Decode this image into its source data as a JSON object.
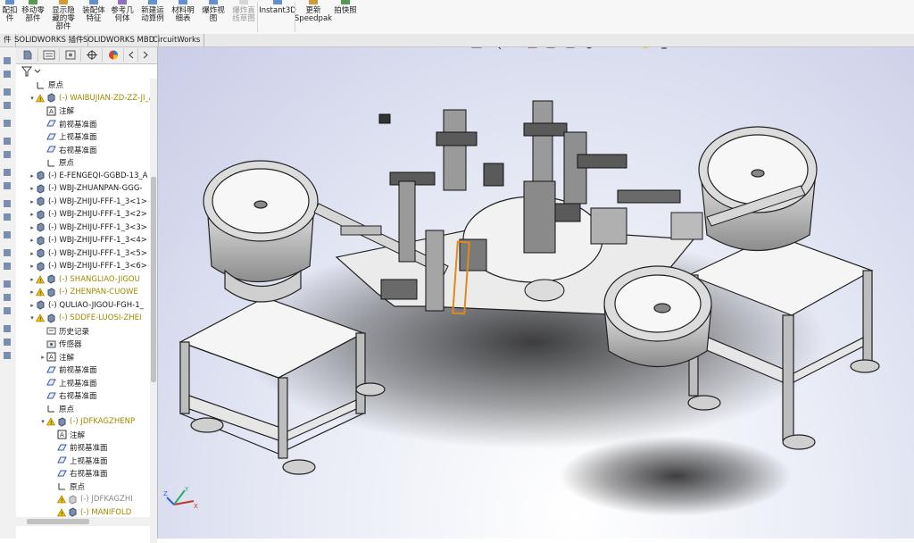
{
  "ribbon": {
    "items": [
      {
        "label": "配扣\n件",
        "icon": "mate-icon",
        "dim": false
      },
      {
        "label": "移动零\n部件",
        "icon": "move-component-icon",
        "dim": false
      },
      {
        "label": "显示隐\n藏的零\n部件",
        "icon": "show-hidden-icon",
        "dim": false
      },
      {
        "label": "装配体\n特征",
        "icon": "assembly-feature-icon",
        "dim": false
      },
      {
        "label": "参考几\n何体",
        "icon": "reference-geometry-icon",
        "dim": false
      },
      {
        "label": "新建运\n动算例",
        "icon": "motion-study-icon",
        "dim": false
      },
      {
        "label": "材料明\n细表",
        "icon": "bom-icon",
        "dim": false
      },
      {
        "label": "爆炸视\n图",
        "icon": "exploded-view-icon",
        "dim": false
      },
      {
        "label": "爆炸直\n线草图",
        "icon": "explode-line-sketch-icon",
        "dim": true
      },
      {
        "label": "Instant3D",
        "icon": "instant3d-icon",
        "dim": false
      },
      {
        "label": "更新\nSpeedpak",
        "icon": "speedpak-icon",
        "dim": false
      },
      {
        "label": "拍快照",
        "icon": "snapshot-icon",
        "dim": false
      }
    ]
  },
  "tabs": [
    "件",
    "SOLIDWORKS 插件",
    "SOLIDWORKS MBD",
    "CircuitWorks"
  ],
  "tree": {
    "rows": [
      {
        "text": "原点",
        "type": "origin",
        "warn": false,
        "dim": false
      },
      {
        "text": "(-) WAIBUJIAN-ZD-ZZ-JI_A",
        "type": "assembly",
        "warn": true,
        "dim": false
      },
      {
        "text": "注解",
        "type": "annotation",
        "warn": false,
        "dim": false
      },
      {
        "text": "前视基准面",
        "type": "plane",
        "warn": false,
        "dim": false
      },
      {
        "text": "上视基准面",
        "type": "plane",
        "warn": false,
        "dim": false
      },
      {
        "text": "右视基准面",
        "type": "plane",
        "warn": false,
        "dim": false
      },
      {
        "text": "原点",
        "type": "origin",
        "warn": false,
        "dim": false
      },
      {
        "text": "(-) E-FENGEQI-GGBD-13_A",
        "type": "assembly",
        "warn": false,
        "dim": false
      },
      {
        "text": "(-) WBJ-ZHUANPAN-GGG-",
        "type": "assembly",
        "warn": false,
        "dim": false
      },
      {
        "text": "(-) WBJ-ZHIJU-FFF-1_3<1>",
        "type": "assembly",
        "warn": false,
        "dim": false
      },
      {
        "text": "(-) WBJ-ZHIJU-FFF-1_3<2>",
        "type": "assembly",
        "warn": false,
        "dim": false
      },
      {
        "text": "(-) WBJ-ZHIJU-FFF-1_3<3>",
        "type": "assembly",
        "warn": false,
        "dim": false
      },
      {
        "text": "(-) WBJ-ZHIJU-FFF-1_3<4>",
        "type": "assembly",
        "warn": false,
        "dim": false
      },
      {
        "text": "(-) WBJ-ZHIJU-FFF-1_3<5>",
        "type": "assembly",
        "warn": false,
        "dim": false
      },
      {
        "text": "(-) WBJ-ZHIJU-FFF-1_3<6>",
        "type": "assembly",
        "warn": false,
        "dim": false
      },
      {
        "text": "(-) SHANGLIAO-JIGOU",
        "type": "assembly",
        "warn": true,
        "dim": false
      },
      {
        "text": "(-) ZHENPAN-CUOWE",
        "type": "assembly",
        "warn": true,
        "dim": false
      },
      {
        "text": "(-) QULIAO-JIGOU-FGH-1_",
        "type": "assembly",
        "warn": false,
        "dim": false
      },
      {
        "text": "(-) SDDFE-LUOSI-ZHEI",
        "type": "assembly",
        "warn": true,
        "dim": false
      },
      {
        "text": "历史记录",
        "type": "history",
        "warn": false,
        "dim": false
      },
      {
        "text": "传感器",
        "type": "sensor",
        "warn": false,
        "dim": false
      },
      {
        "text": "注解",
        "type": "annotation",
        "warn": false,
        "dim": false
      },
      {
        "text": "前视基准面",
        "type": "plane",
        "warn": false,
        "dim": false
      },
      {
        "text": "上视基准面",
        "type": "plane",
        "warn": false,
        "dim": false
      },
      {
        "text": "右视基准面",
        "type": "plane",
        "warn": false,
        "dim": false
      },
      {
        "text": "原点",
        "type": "origin",
        "warn": false,
        "dim": false
      },
      {
        "text": "(-) JDFKAGZHENP",
        "type": "assembly",
        "warn": true,
        "dim": false
      },
      {
        "text": "注解",
        "type": "annotation",
        "warn": false,
        "dim": false
      },
      {
        "text": "前视基准面",
        "type": "plane",
        "warn": false,
        "dim": false
      },
      {
        "text": "上视基准面",
        "type": "plane",
        "warn": false,
        "dim": false
      },
      {
        "text": "右视基准面",
        "type": "plane",
        "warn": false,
        "dim": false
      },
      {
        "text": "原点",
        "type": "origin",
        "warn": false,
        "dim": false
      },
      {
        "text": "(-) JDFKAGZHI",
        "type": "part",
        "warn": true,
        "dim": true
      },
      {
        "text": "(-) MANIFOLD",
        "type": "assembly",
        "warn": true,
        "dim": false
      }
    ]
  },
  "triad": {
    "x": "X",
    "y": "Y",
    "z": "Z"
  },
  "colors": {
    "warning": "#f2c200",
    "assembly_icon": "#7a8fb0",
    "viewport_bg": "#c9cde7",
    "machine_gray": "#cfcfcf",
    "highlight_orange": "#e08a1c"
  }
}
